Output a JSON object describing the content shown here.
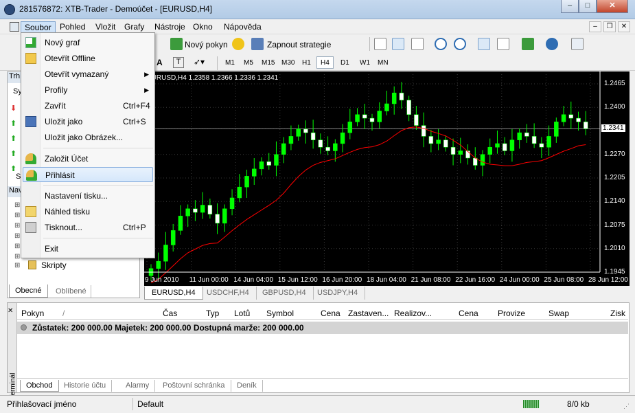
{
  "window": {
    "title": "281576872: XTB-Trader - Demoúčet - [EURUSD,H4]",
    "minimize": "–",
    "maximize": "□",
    "close": "✕"
  },
  "menubar": {
    "items": [
      "Soubor",
      "Pohled",
      "Vložit",
      "Grafy",
      "Nástroje",
      "Okno",
      "Nápověda"
    ],
    "active": "Soubor"
  },
  "mdi": {
    "minimize": "–",
    "restore": "❐",
    "close": "✕"
  },
  "toolbar": {
    "new_order": "Nový pokyn",
    "start_strategies": "Zapnout strategie"
  },
  "timeframes": [
    "M1",
    "M5",
    "M15",
    "M30",
    "H1",
    "H4",
    "D1",
    "W1",
    "MN"
  ],
  "timeframe_selected": "H4",
  "soubor_menu": [
    {
      "label": "Nový graf",
      "shortcut": "",
      "icon": "new-chart-icon"
    },
    {
      "label": "Otevřít Offline",
      "shortcut": "",
      "icon": "folder-icon"
    },
    {
      "label": "Otevřít vymazaný",
      "shortcut": "",
      "submenu": true
    },
    {
      "label": "Profily",
      "shortcut": "",
      "submenu": true
    },
    {
      "label": "Zavřít",
      "shortcut": "Ctrl+F4"
    },
    {
      "label": "Uložit jako",
      "shortcut": "Ctrl+S",
      "icon": "save-icon"
    },
    {
      "label": "Uložit jako Obrázek...",
      "shortcut": ""
    },
    {
      "label": "Založit Účet",
      "shortcut": "",
      "icon": "add-user-icon"
    },
    {
      "label": "Přihlásit",
      "shortcut": "",
      "icon": "login-icon"
    },
    {
      "label": "Nastavení tisku...",
      "shortcut": ""
    },
    {
      "label": "Náhled tisku",
      "shortcut": "",
      "icon": "print-preview-icon"
    },
    {
      "label": "Tisknout...",
      "shortcut": "Ctrl+P",
      "icon": "printer-icon"
    },
    {
      "label": "Exit",
      "shortcut": ""
    }
  ],
  "left_panel": {
    "market_header": "Trh",
    "market_col": "Sy",
    "market_s": "S",
    "navigator_header": "Nav",
    "tree_last": "Skripty",
    "tabs": [
      "Obecné",
      "Oblíbené"
    ]
  },
  "chart": {
    "info": "EURUSD,H4  1.2358 1.2366 1.2336 1.2341",
    "y_ticks": [
      "1.2465",
      "1.2400",
      "1.2341",
      "1.2270",
      "1.2205",
      "1.2140",
      "1.2075",
      "1.2010",
      "1.1945"
    ],
    "current_price": "1.2341",
    "x_ticks": [
      "9 Jun 2010",
      "11 Jun 00:00",
      "14 Jun 04:00",
      "15 Jun 12:00",
      "16 Jun 20:00",
      "18 Jun 04:00",
      "21 Jun 08:00",
      "22 Jun 16:00",
      "24 Jun 00:00",
      "25 Jun 08:00",
      "28 Jun 12:00"
    ],
    "tabs": [
      "EURUSD,H4",
      "USDCHF,H4",
      "GBPUSD,H4",
      "USDJPY,H4"
    ],
    "active_tab": "EURUSD,H4"
  },
  "chart_data": {
    "type": "candlestick",
    "symbol": "EURUSD",
    "timeframe": "H4",
    "ylim": [
      1.1945,
      1.2465
    ],
    "last": {
      "open": 1.2358,
      "high": 1.2366,
      "low": 1.2336,
      "close": 1.2341
    },
    "close_values": [
      1.1955,
      1.1975,
      1.202,
      1.206,
      1.21,
      1.212,
      1.211,
      1.213,
      1.2105,
      1.208,
      1.212,
      1.215,
      1.218,
      1.221,
      1.223,
      1.225,
      1.224,
      1.227,
      1.23,
      1.232,
      1.234,
      1.233,
      1.231,
      1.229,
      1.228,
      1.23,
      1.233,
      1.236,
      1.238,
      1.237,
      1.236,
      1.239,
      1.241,
      1.244,
      1.242,
      1.238,
      1.235,
      1.232,
      1.23,
      1.231,
      1.229,
      1.227,
      1.228,
      1.226,
      1.224,
      1.227,
      1.229,
      1.23,
      1.228,
      1.231,
      1.233,
      1.232,
      1.23,
      1.229,
      1.232,
      1.236,
      1.238,
      1.237,
      1.236,
      1.2341
    ]
  },
  "terminal": {
    "side_label": "Terminál",
    "columns": [
      "Pokyn",
      "Čas",
      "Typ",
      "Lotů",
      "Symbol",
      "Cena",
      "Zastaven...",
      "Realizov...",
      "Cena",
      "Provize",
      "Swap",
      "Zisk"
    ],
    "summary": "Zůstatek: 200 000.00  Majetek: 200 000.00  Dostupná marže: 200 000.00",
    "tabs": [
      "Obchod",
      "Historie účtu",
      "Alarmy",
      "Poštovní schránka",
      "Deník"
    ]
  },
  "statusbar": {
    "left": "Přihlašovací jméno",
    "profile": "Default",
    "traffic": "8/0 kb"
  },
  "colors": {
    "bull": "#00ff00",
    "bear": "#ffffff",
    "ma": "#ff0000",
    "chart_bg": "#000000",
    "grid": "#3a3a3a"
  }
}
